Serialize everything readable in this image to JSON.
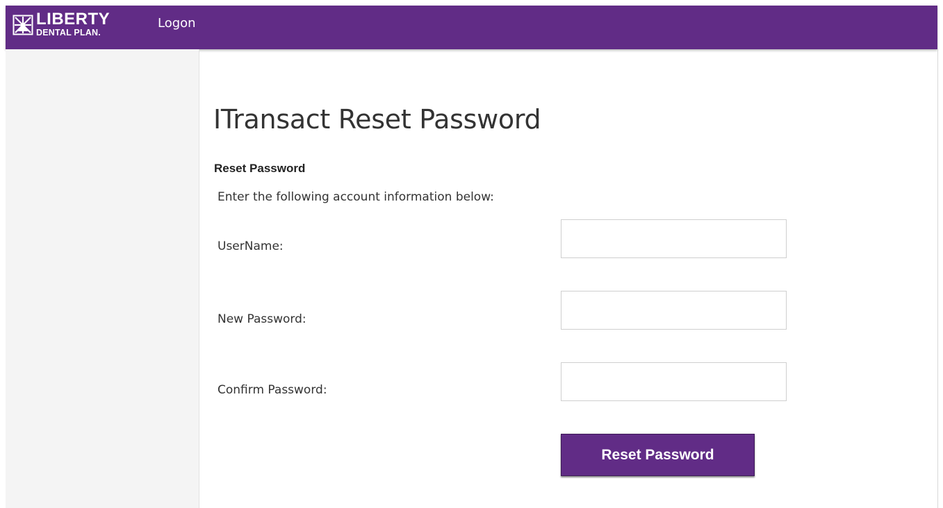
{
  "brand": {
    "name_line1": "LIBERTY",
    "name_line2": "DENTAL PLAN.",
    "logo_icon": "liberty-star-logo-icon",
    "color": "#612c86"
  },
  "nav": {
    "logon_label": "Logon"
  },
  "page": {
    "title": "ITransact Reset Password",
    "section_heading": "Reset Password",
    "instructions": "Enter the following account information below:"
  },
  "form": {
    "username": {
      "label": "UserName:",
      "value": "",
      "placeholder": ""
    },
    "new_password": {
      "label": "New Password:",
      "value": "",
      "placeholder": ""
    },
    "confirm_password": {
      "label": "Confirm Password:",
      "value": "",
      "placeholder": ""
    },
    "submit_label": "Reset Password"
  }
}
